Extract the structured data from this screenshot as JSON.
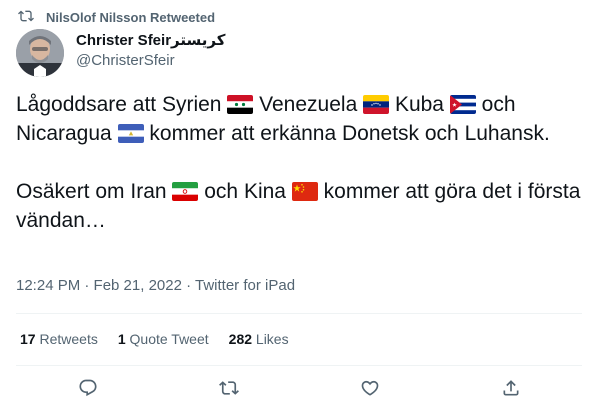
{
  "retweet_header": {
    "text": "NilsOlof Nilsson Retweeted",
    "icon": "retweet-icon"
  },
  "author": {
    "display_name": "Christer Sfeirكريستر",
    "handle": "@ChristerSfeir"
  },
  "tweet": {
    "p1_a": "Lågoddsare att Syrien",
    "p1_b": "Venezuela",
    "p1_c": "Kuba",
    "p1_d": "och",
    "p1_e": "Nicaragua",
    "p1_f": "kommer att erkänna Donetsk och Luhansk.",
    "p2_a": "Osäkert om Iran",
    "p2_b": "och Kina",
    "p2_c": "kommer att göra det i första vändan…"
  },
  "flags": [
    "syria-flag",
    "venezuela-flag",
    "cuba-flag",
    "nicaragua-flag",
    "iran-flag",
    "china-flag"
  ],
  "meta": {
    "time": "12:24 PM · Feb 21, 2022 · ",
    "source": "Twitter for iPad"
  },
  "stats": {
    "retweets_count": "17",
    "retweets_label": "Retweets",
    "quotes_count": "1",
    "quotes_label": "Quote Tweet",
    "likes_count": "282",
    "likes_label": "Likes"
  },
  "actions": [
    "reply-icon",
    "retweet-icon",
    "like-icon",
    "share-icon"
  ],
  "colors": {
    "text": "#0f1419",
    "secondary": "#536471",
    "divider": "#eff3f4"
  }
}
